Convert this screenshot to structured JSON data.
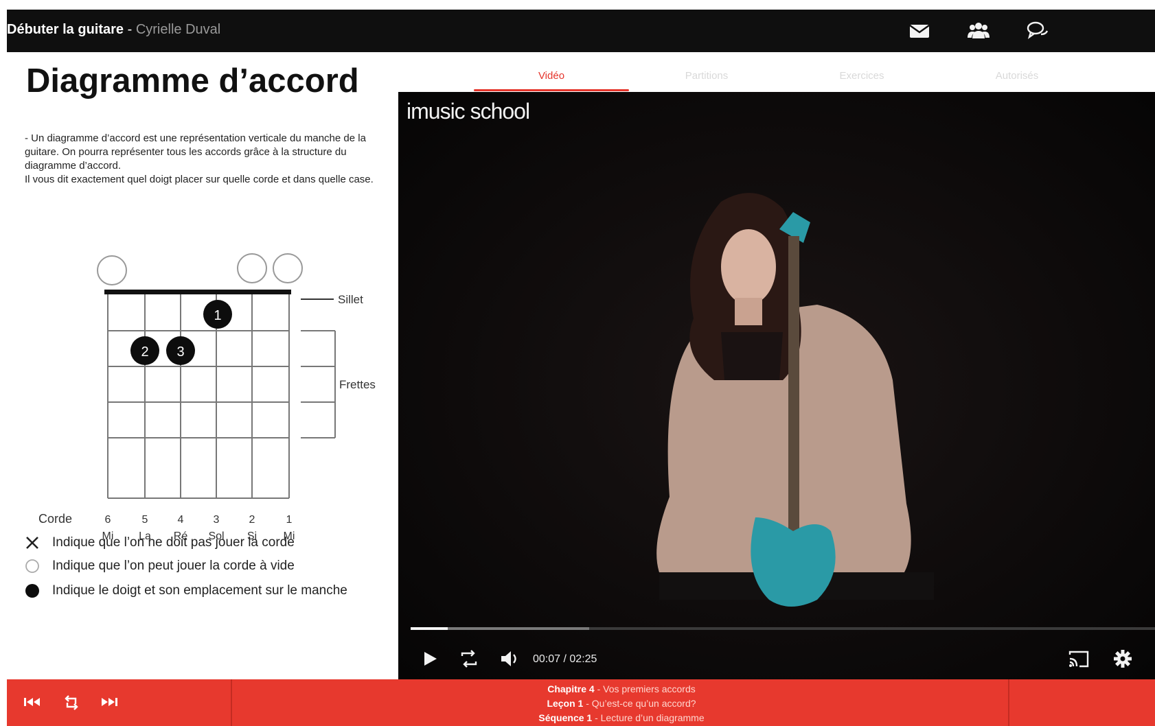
{
  "header": {
    "course_title": "Débuter la guitare",
    "separator": " - ",
    "author": "Cyrielle Duval",
    "icons": [
      "mail-icon",
      "users-icon",
      "chat-icon"
    ]
  },
  "lesson": {
    "title": "Diagramme d’accord",
    "description": [
      "- Un diagramme d’accord est une représentation verticale du manche de la guitare. On pourra représenter tous les accords grâce à la structure du diagramme d’accord.",
      "Il vous dit exactement quel doigt placer sur quelle corde et dans quelle case."
    ]
  },
  "chord_diagram": {
    "sillet_label": "Sillet",
    "frettes_label": "Frettes",
    "corde_label": "Corde",
    "strings": [
      {
        "number": "6",
        "note": "Mi"
      },
      {
        "number": "5",
        "note": "La"
      },
      {
        "number": "4",
        "note": "Ré"
      },
      {
        "number": "3",
        "note": "Sol"
      },
      {
        "number": "2",
        "note": "Si"
      },
      {
        "number": "1",
        "note": "Mi"
      }
    ],
    "open_strings": [
      "6",
      "2",
      "1"
    ],
    "fingers": [
      {
        "finger": "1",
        "string": "3",
        "fret": 1
      },
      {
        "finger": "2",
        "string": "5",
        "fret": 2
      },
      {
        "finger": "3",
        "string": "4",
        "fret": 2
      }
    ]
  },
  "legend": [
    {
      "icon": "x-icon",
      "text": "Indique que l’on ne doit pas jouer la corde"
    },
    {
      "icon": "open-circle-icon",
      "text": "Indique que l’on peut jouer la corde à vide"
    },
    {
      "icon": "filled-circle-icon",
      "text": "Indique le doigt et son emplacement sur le manche"
    }
  ],
  "tabs": [
    {
      "label": "Vidéo",
      "active": true
    },
    {
      "label": "Partitions",
      "active": false
    },
    {
      "label": "Exercices",
      "active": false
    },
    {
      "label": "Autorisés",
      "active": false
    }
  ],
  "player": {
    "brand": "imusic school",
    "current_time": "00:07",
    "time_separator": " / ",
    "duration": "02:25",
    "played_fraction": 0.05,
    "buffered_fraction": 0.24
  },
  "footer": {
    "chapter_label": "Chapitre 4",
    "chapter_text": " - Vos premiers accords",
    "lesson_label": "Leçon 1",
    "lesson_text": " - Qu’est-ce qu’un accord?",
    "sequence_label": "Séquence 1",
    "sequence_text": " - Lecture d’un diagramme"
  },
  "colors": {
    "accent": "#e5332a",
    "topbar": "#0f0f0f",
    "bottombar": "#e7392e"
  }
}
